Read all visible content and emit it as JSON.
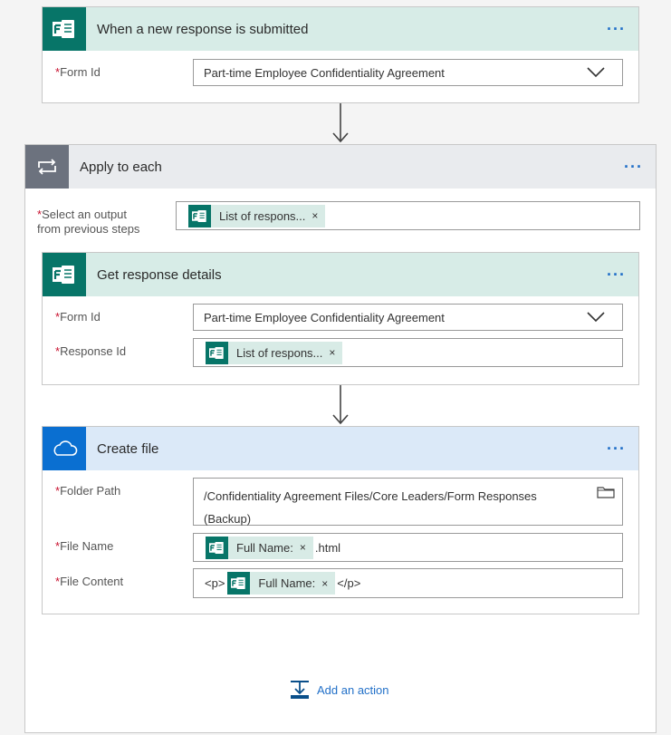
{
  "trigger": {
    "title": "When a new response is submitted",
    "more_label": "···",
    "form_id": {
      "label": "Form Id",
      "value": "Part-time Employee Confidentiality Agreement"
    }
  },
  "apply_each": {
    "title": "Apply to each",
    "more_label": "···",
    "select_output": {
      "label_line1": "Select an output",
      "label_line2": "from previous steps",
      "token": "List of respons...",
      "remove": "×"
    }
  },
  "get_details": {
    "title": "Get response details",
    "more_label": "···",
    "form_id": {
      "label": "Form Id",
      "value": "Part-time Employee Confidentiality Agreement"
    },
    "response_id": {
      "label": "Response Id",
      "token": "List of respons...",
      "remove": "×"
    }
  },
  "create_file": {
    "title": "Create file",
    "more_label": "···",
    "folder_path": {
      "label": "Folder Path",
      "line1": "/Confidentiality Agreement Files/Core Leaders/Form Responses",
      "line2": "(Backup)"
    },
    "file_name": {
      "label": "File Name",
      "token": "Full Name:",
      "remove": "×",
      "suffix": ".html"
    },
    "file_content": {
      "label": "File Content",
      "prefix": "<p>",
      "token": "Full Name:",
      "remove": "×",
      "suffix": "</p>"
    }
  },
  "add_action": {
    "label": "Add an action"
  },
  "required_marker": "*",
  "colors": {
    "forms": "#077568",
    "onedrive": "#0a6fd1",
    "loop": "#6c727e",
    "link": "#2270c8",
    "required": "#c8102e"
  },
  "icons": [
    "forms-icon",
    "loop-icon",
    "onedrive-cloud-icon",
    "chevron-down-icon",
    "folder-icon",
    "add-action-icon"
  ]
}
